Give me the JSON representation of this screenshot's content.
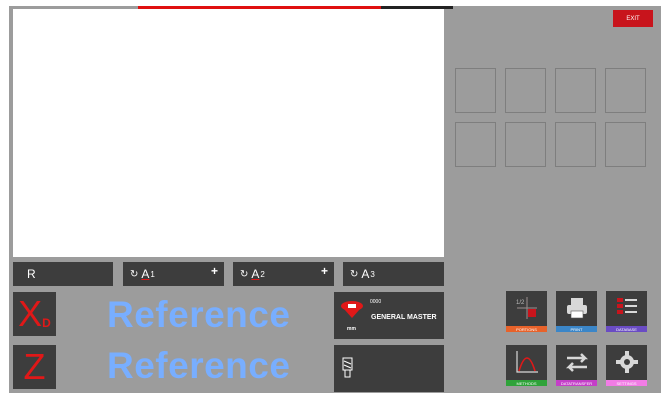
{
  "header": {
    "exit_label": "EXIT"
  },
  "angle_row": {
    "r_label": "R",
    "a1": {
      "label": "A",
      "sub": "1",
      "plus": "+"
    },
    "a2": {
      "label": "A",
      "sub": "2",
      "plus": "+"
    },
    "a3": {
      "label": "A",
      "sub": "3"
    }
  },
  "axes": [
    {
      "label": "X",
      "sub": "D",
      "value": "Reference"
    },
    {
      "label": "Z",
      "sub": "",
      "value": "Reference"
    }
  ],
  "tool_holder": {
    "code": "0000",
    "name": "GENERAL MASTER",
    "unit": "mm"
  },
  "menu": {
    "portions": "PORTIONS",
    "print": "PRINT",
    "database": "DATABASE",
    "methods": "METHODS",
    "datatransfer": "DATATRANSFER",
    "settings": "SETTINGS"
  },
  "colors": {
    "accent_red": "#e01818",
    "value_blue": "#78aeff",
    "portions": "#e8622a",
    "print": "#3b86c8",
    "database": "#6a4cc4",
    "methods": "#2fa33a",
    "datatransfer": "#c43fc8",
    "settings": "#f27ce6"
  }
}
